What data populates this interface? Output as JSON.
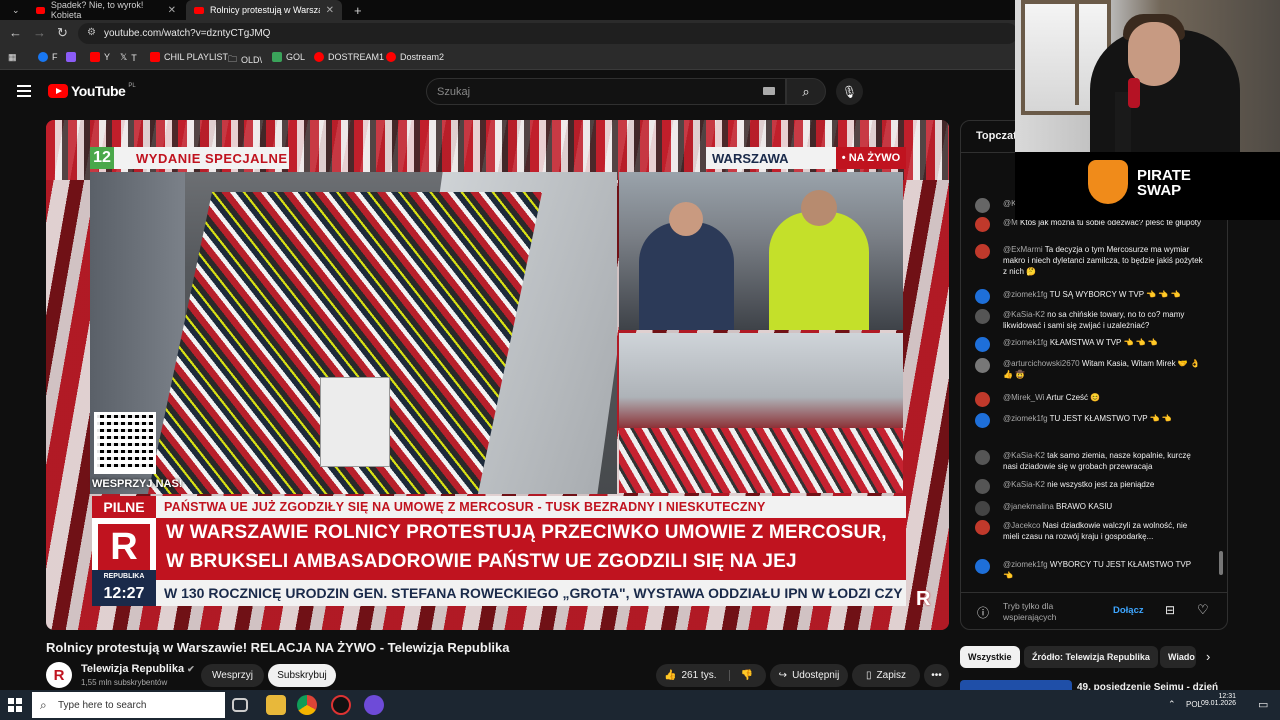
{
  "browser": {
    "tabs": [
      {
        "label": "Spadek? Nie, to wyrok! Kobieta"
      },
      {
        "label": "Rolnicy protestują w Warszawie"
      }
    ],
    "new_tab": "+",
    "url": "youtube.com/watch?v=dzntyCTgJMQ",
    "bookmarks": [
      {
        "label": "F",
        "color": "#1877f2"
      },
      {
        "label": "",
        "color": "#8b5cf6"
      },
      {
        "label": "Y",
        "color": "#ff0000"
      },
      {
        "label": "T",
        "color": "#ffffff"
      },
      {
        "label": "CHIL PLAYLIST",
        "color": "#ff0000"
      },
      {
        "label": "OLD\\",
        "color": "#bbbbbb"
      },
      {
        "label": "GOL",
        "color": "#3aa35a"
      },
      {
        "label": "DOSTREAM1",
        "color": "#ff0000"
      },
      {
        "label": "Dostream2",
        "color": "#ff0000"
      }
    ]
  },
  "youtube": {
    "logo_word": "YouTube",
    "logo_region": "PL",
    "search_placeholder": "Szukaj"
  },
  "video": {
    "badge_channel_number": "12",
    "badge_special": "WYDANIE SPECJALNE",
    "location": "WARSZAWA",
    "live": "• NA ŻYWO",
    "qr_label": "WESPRZYJ NAS!",
    "pilne_label": "PILNE",
    "pilne_text": "PAŃSTWA UE JUŻ ZGODZIŁY SIĘ NA UMOWĘ Z MERCOSUR - TUSK BEZRADNY I NIESKUTECZNY",
    "headline_line1": "W WARSZAWIE ROLNICY PROTESTUJĄ PRZECIWKO UMOWIE Z MERCOSUR,",
    "headline_line2": "W BRUKSELI AMBASADOROWIE PAŃSTW UE ZGODZILI SIĘ NA JEJ PODPISANIE",
    "scroller": "W 130 ROCZNICĘ URODZIN GEN. STEFANA ROWECKIEGO „GROTA\", WYSTAWA ODDZIAŁU IPN W ŁODZI CZY",
    "logo_letter": "R",
    "logo_name": "REPUBLIKA",
    "clock": "12:27",
    "corner_logo": "R",
    "title": "Rolnicy protestują w Warszawie! RELACJA NA ŻYWO - Telewizja Republika"
  },
  "channel": {
    "avatar_letter": "R",
    "name": "Telewizja Republika",
    "subs": "1,55 mln subskrybentów",
    "support_label": "Wesprzyj",
    "subscribe_label": "Subskrybuj"
  },
  "actions": {
    "likes": "261 tys.",
    "share": "Udostępnij",
    "save": "Zapisz",
    "more": "•••"
  },
  "chat": {
    "header": "Topczat",
    "messages": [
      {
        "user": "@K",
        "text": "",
        "avatar_color": "#666666"
      },
      {
        "user": "@M",
        "text": "Ktoś jak można tu sobie odezwać? pleść te głupoty",
        "avatar_color": "#c0392b"
      },
      {
        "user": "@ExMarmi",
        "text": "Ta decyzja o tym Mercosurze ma wymiar makro i niech dyletanci zamilcza, to będzie jakiś pożytek z nich 🤔",
        "avatar_color": "#c0392b"
      },
      {
        "user": "@ziomek1fg",
        "text": "TU SĄ WYBORCY W TVP 👈 👈 👈",
        "avatar_color": "#1e6fd9"
      },
      {
        "user": "@KaSia-K2",
        "text": "no sa chińskie towary, no to co? mamy likwidować i sami się zwijać i uzależniać?",
        "avatar_color": "#555555"
      },
      {
        "user": "@ziomek1fg",
        "text": "KŁAMSTWA W TVP 👈 👈 👈",
        "avatar_color": "#1e6fd9"
      },
      {
        "user": "@arturcichowski2670",
        "text": "Witam Kasia, Witam Mirek 🤝 👌 👍 🤠",
        "avatar_color": "#777777"
      },
      {
        "user": "@Mirek_Wi",
        "text": "Artur Cześć 😊",
        "avatar_color": "#c0392b"
      },
      {
        "user": "@ziomek1fg",
        "text": "TU JEST KŁAMSTWO TVP 👈 👈",
        "avatar_color": "#1e6fd9"
      },
      {
        "user": "@KaSia-K2",
        "text": "tak samo ziemia, nasze kopalnie, kurczę nasi dziadowie się w grobach przewracaja",
        "avatar_color": "#555555"
      },
      {
        "user": "@KaSia-K2",
        "text": "nie wszystko jest za pieniądze",
        "avatar_color": "#555555"
      },
      {
        "user": "@janekmalina",
        "text": "BRAWO KASIU",
        "avatar_color": "#444444"
      },
      {
        "user": "@Jacekco",
        "text": "Nasi dziadkowie walczyli za wolność, nie mieli czasu na rozwój kraju i gospodarkę...",
        "avatar_color": "#c0392b"
      },
      {
        "user": "@ziomek1fg",
        "text": "WYBORCY TU JEST KŁAMSTWO TVP 👈",
        "avatar_color": "#1e6fd9"
      }
    ],
    "input_placeholder": "Tryb tylko dla wspierających",
    "join": "Dołącz"
  },
  "chips": [
    "Wszystkie",
    "Źródło: Telewizja Republika",
    "Wiado"
  ],
  "next_video_title": "49. posiedzenie Sejmu - dzień",
  "overlay": {
    "brand_line1": "PIRATE",
    "brand_line2": "SWAP"
  },
  "taskbar": {
    "search": "Type here to search",
    "lang": "POL",
    "time": "12:31",
    "date": "09.01.2026"
  }
}
